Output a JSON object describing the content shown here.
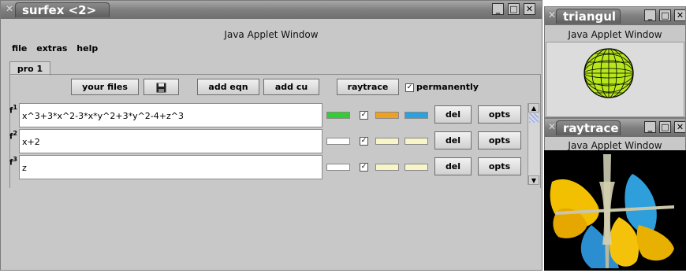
{
  "windows": {
    "surfex": {
      "title": "surfex <2>",
      "subtitle": "Java Applet Window",
      "controls": {
        "minimize": "_",
        "maximize": "□",
        "close": "✕"
      },
      "menu": [
        "file",
        "extras",
        "help"
      ],
      "tabs": [
        {
          "label": "pro 1",
          "active": true
        }
      ],
      "toolbar": {
        "your_files": "your files",
        "add_eqn": "add eqn",
        "add_cu": "add cu",
        "raytrace": "raytrace",
        "permanently": "permanently",
        "permanently_checked": true
      },
      "rows": [
        {
          "label": "f",
          "index": "1",
          "equation": "x^3+3*x^2-3*x*y^2+3*y^2-4+z^3",
          "colors": [
            "#33cc33",
            "#f0a020",
            "#2aa2e0"
          ],
          "checked": true,
          "del": "del",
          "opts": "opts"
        },
        {
          "label": "f",
          "index": "2",
          "equation": "x+2",
          "colors": [
            "#ffffff",
            "#f8f5c8",
            "#f8f5c8"
          ],
          "checked": true,
          "del": "del",
          "opts": "opts"
        },
        {
          "label": "f",
          "index": "3",
          "equation": "z",
          "colors": [
            "#ffffff",
            "#f8f5c8",
            "#f8f5c8"
          ],
          "checked": true,
          "del": "del",
          "opts": "opts"
        }
      ]
    },
    "triangul": {
      "title": "triangul",
      "subtitle": "Java Applet Window",
      "controls": {
        "minimize": "_",
        "maximize": "□",
        "close": "✕"
      }
    },
    "raytrace": {
      "title": "raytrace",
      "subtitle": "Java Applet Window",
      "controls": {
        "minimize": "_",
        "maximize": "□",
        "close": "✕"
      }
    }
  },
  "icons": {
    "save": "floppy-disk-icon",
    "checkmark": "✓"
  }
}
